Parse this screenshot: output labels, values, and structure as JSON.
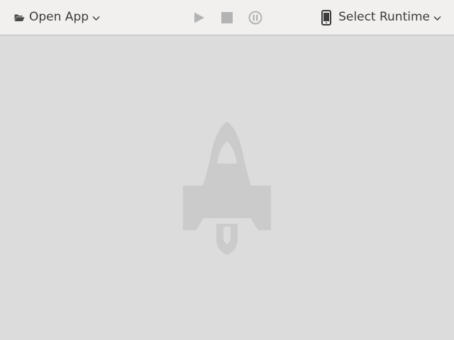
{
  "toolbar": {
    "open_app": {
      "label": "Open App",
      "icon": "folder-open-icon"
    },
    "controls": {
      "play_icon": "play-icon",
      "stop_icon": "stop-icon",
      "pause_icon": "pause-icon"
    },
    "select_runtime": {
      "label": "Select Runtime",
      "icon": "phone-icon"
    }
  },
  "main": {
    "placeholder_icon": "rocket-icon"
  },
  "colors": {
    "toolbar_bg": "#f1f0ef",
    "content_bg": "#dcdcdc",
    "text": "#3c3c3c",
    "disabled_control": "#b3b3b3",
    "rocket": "#cbcbcb"
  }
}
